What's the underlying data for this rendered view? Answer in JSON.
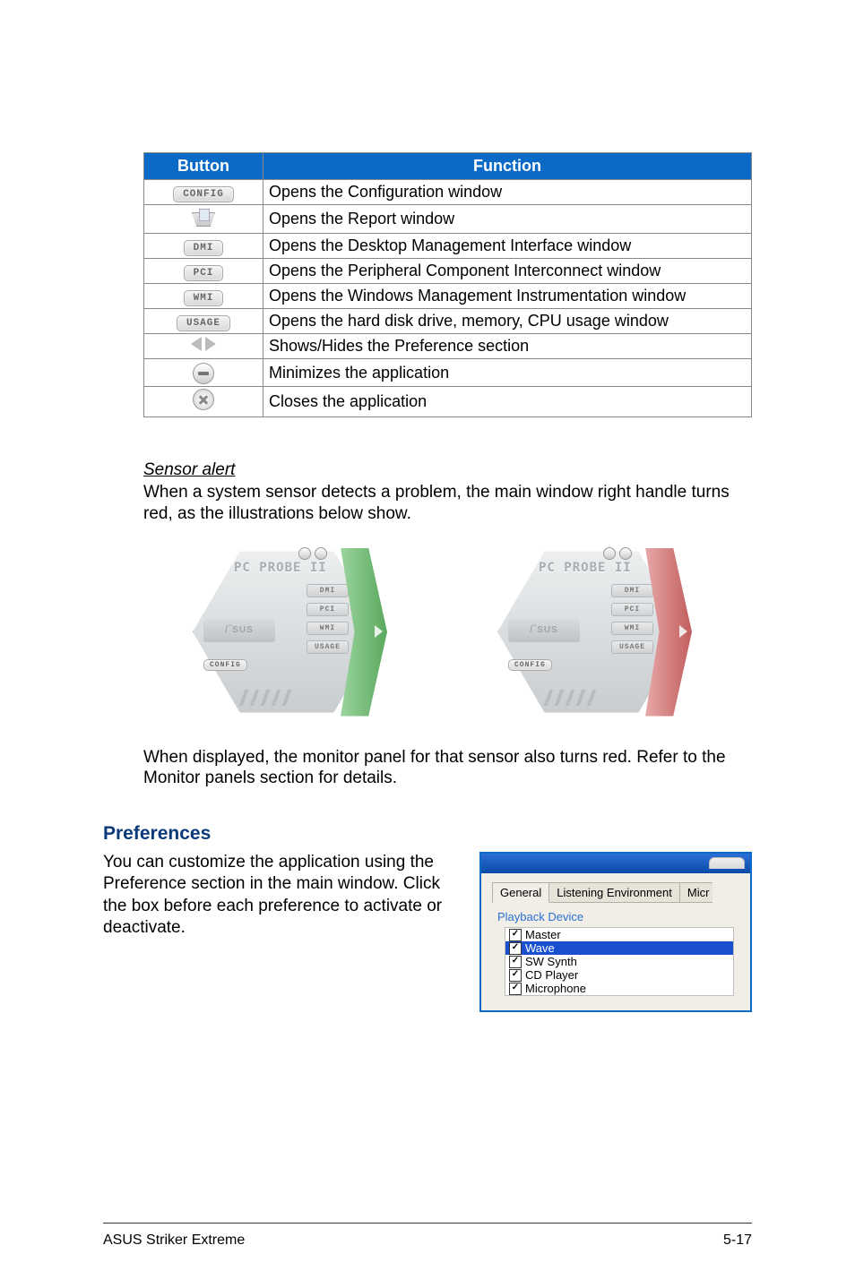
{
  "table": {
    "headers": {
      "button": "Button",
      "function": "Function"
    },
    "rows": [
      {
        "icon": "config",
        "label": "CONFIG",
        "function": "Opens the Configuration window"
      },
      {
        "icon": "report",
        "function": "Opens the Report window"
      },
      {
        "icon": "dmi",
        "label": "DMI",
        "function": "Opens the Desktop Management Interface window"
      },
      {
        "icon": "pci",
        "label": "PCI",
        "function": "Opens the Peripheral Component Interconnect window"
      },
      {
        "icon": "wmi",
        "label": "WMI",
        "function": "Opens the Windows Management Instrumentation window"
      },
      {
        "icon": "usage",
        "label": "USAGE",
        "function": "Opens the hard disk drive, memory, CPU usage window"
      },
      {
        "icon": "arrows",
        "function": "Shows/Hides the Preference section"
      },
      {
        "icon": "minimize",
        "function": "Minimizes the application"
      },
      {
        "icon": "close",
        "function": "Closes the application"
      }
    ]
  },
  "sensor": {
    "title": "Sensor alert",
    "p1": "When a system sensor detects a problem, the main window right handle turns red, as the illustrations below show.",
    "p2": "When displayed, the monitor panel for that sensor also turns red. Refer to the Monitor panels section for details."
  },
  "hex": {
    "logo": "PC PROBE II",
    "config": "CONFIG",
    "buttons": [
      "DMI",
      "PCI",
      "WMI",
      "USAGE"
    ]
  },
  "preferences": {
    "heading": "Preferences",
    "text": "You can customize the application using the Preference section in the main window. Click the box before each preference to activate or deactivate.",
    "tabs": {
      "general": "General",
      "listening": "Listening Environment",
      "micr": "Micr"
    },
    "fieldset_label": "Playback Device",
    "devices": [
      "Master",
      "Wave",
      "SW Synth",
      "CD Player",
      "Microphone"
    ]
  },
  "footer": {
    "left": "ASUS Striker Extreme",
    "right": "5-17"
  }
}
